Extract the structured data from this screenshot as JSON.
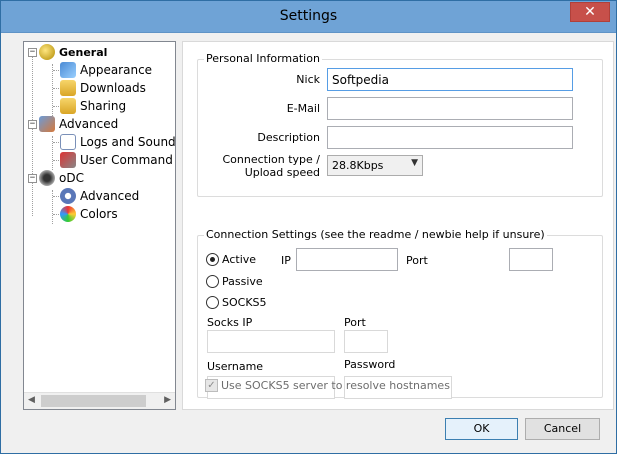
{
  "window": {
    "title": "Settings",
    "close_glyph": "✕"
  },
  "tree": {
    "items": [
      {
        "label": "General",
        "expander": "−",
        "icon": "general-icon",
        "bold": true
      },
      {
        "label": "Appearance",
        "icon": "appearance-icon"
      },
      {
        "label": "Downloads",
        "icon": "downloads-folder-icon"
      },
      {
        "label": "Sharing",
        "icon": "sharing-folder-icon"
      },
      {
        "label": "Advanced",
        "expander": "−",
        "icon": "advanced-icon"
      },
      {
        "label": "Logs and Sound",
        "icon": "logs-icon"
      },
      {
        "label": "User Command",
        "icon": "user-command-icon"
      },
      {
        "label": "oDC",
        "expander": "−",
        "icon": "odc-icon"
      },
      {
        "label": "Advanced",
        "icon": "gear-icon"
      },
      {
        "label": "Colors",
        "icon": "colors-icon"
      }
    ]
  },
  "personal": {
    "title": "Personal Information",
    "nick_label": "Nick",
    "nick_value": "Softpedia",
    "email_label": "E-Mail",
    "email_value": "",
    "description_label": "Description",
    "description_value": "",
    "conn_type_label_1": "Connection type /",
    "conn_type_label_2": "Upload speed",
    "conn_type_value": "28.8Kbps"
  },
  "connection": {
    "title": "Connection Settings (see the readme / newbie help if unsure)",
    "active_label": "Active",
    "passive_label": "Passive",
    "socks5_label": "SOCKS5",
    "selected_mode": "Active",
    "ip_label": "IP",
    "ip_value": "",
    "port_label": "Port",
    "port_value": "",
    "socks_ip_label": "Socks IP",
    "socks_port_label": "Port",
    "username_label": "Username",
    "password_label": "Password",
    "resolve_label": "Use SOCKS5 server to resolve hostnames",
    "resolve_checked": true
  },
  "buttons": {
    "ok": "OK",
    "cancel": "Cancel"
  }
}
